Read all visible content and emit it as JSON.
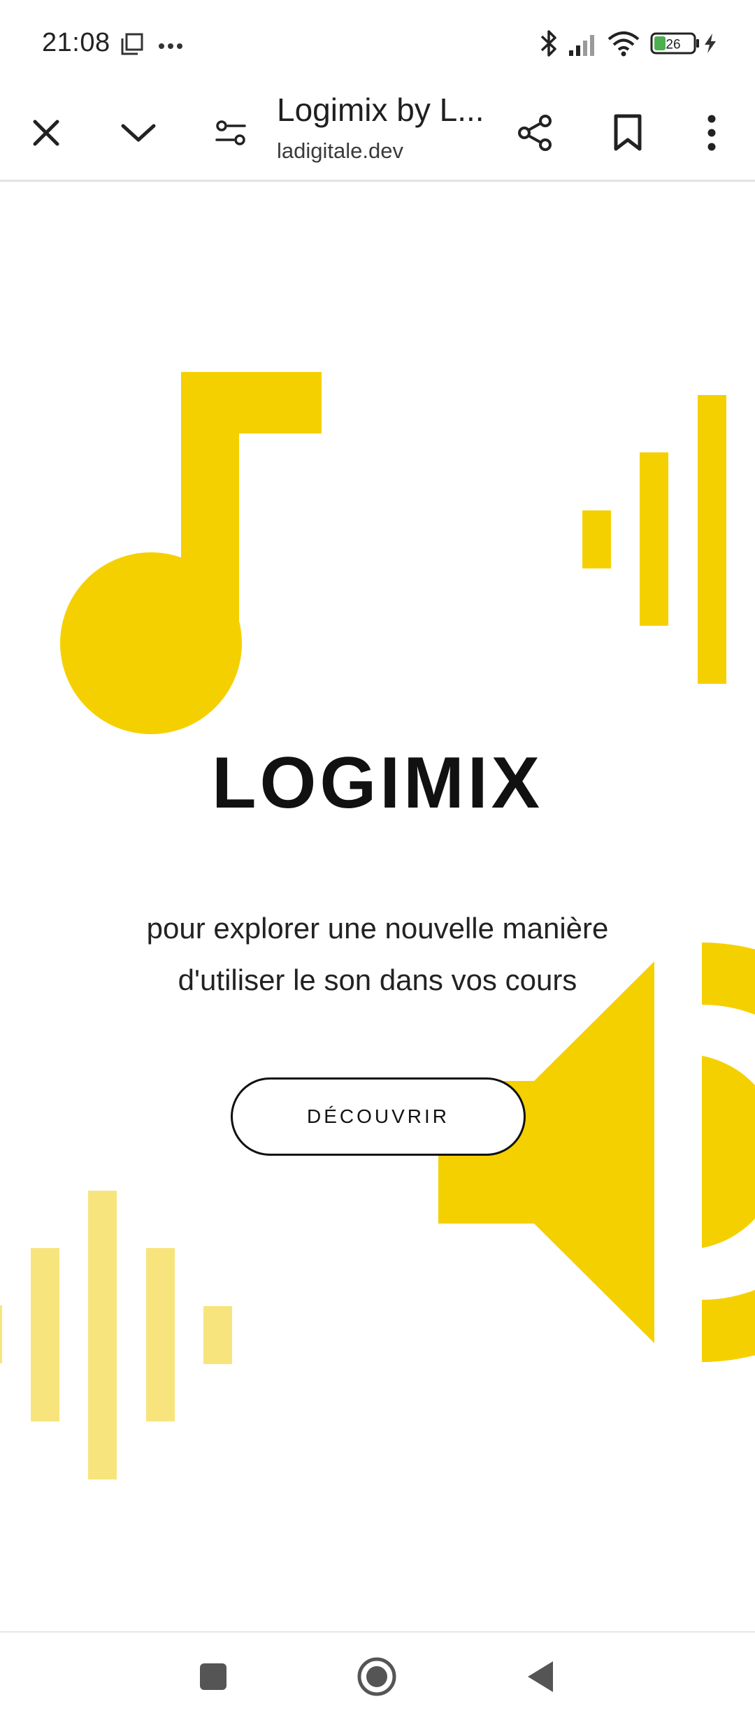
{
  "status_bar": {
    "time": "21:08",
    "battery_level": "26",
    "icons": [
      "screenshot-icon",
      "more-icon",
      "bluetooth-icon",
      "signal-icon",
      "wifi-icon",
      "battery-icon",
      "charging-icon"
    ]
  },
  "browser": {
    "page_title": "Logimix by L...",
    "url": "ladigitale.dev",
    "buttons": [
      "close-icon",
      "chevron-down-icon",
      "site-settings-icon",
      "share-icon",
      "bookmark-icon",
      "more-vert-icon"
    ]
  },
  "page": {
    "title": "LOGIMIX",
    "subtitle": "pour explorer une nouvelle manière d'utiliser le son dans vos cours",
    "cta_label": "DÉCOUVRIR",
    "accent_color": "#F5D000",
    "accent_light_color": "#F8E47C"
  },
  "nav_bar": {
    "buttons": [
      "recents-button",
      "home-button",
      "back-button"
    ]
  }
}
